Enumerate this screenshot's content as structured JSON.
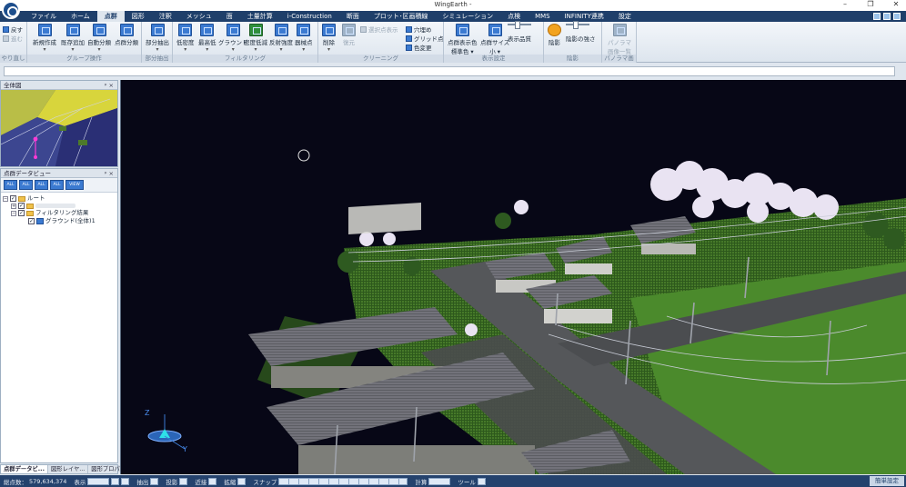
{
  "window": {
    "title": "WingEarth -",
    "controls": [
      "–",
      "❐",
      "✕"
    ]
  },
  "menu": {
    "items": [
      "ファイル",
      "ホーム",
      "点群",
      "図形",
      "注釈",
      "メッシュ",
      "面",
      "土量計算",
      "i-Construction",
      "断面",
      "プロット･区画積線",
      "シミュレーション",
      "点検",
      "MMS",
      "INFINITY連携",
      "設定"
    ],
    "active": "点群"
  },
  "ribbon": {
    "undo": {
      "undo": "戻す",
      "redo": "進む",
      "group": "やり直し"
    },
    "group_edit": {
      "label": "グループ操作",
      "buttons": [
        "新規作成",
        "既存追加",
        "自動分類",
        "点群分類"
      ]
    },
    "partial": {
      "label": "部分抽出",
      "button": "部分抽出"
    },
    "filter": {
      "label": "フィルタリング",
      "buttons": [
        "低密度",
        "最高低",
        "グラウンド",
        "密度低減",
        "反射強度",
        "器械点"
      ]
    },
    "cleaning": {
      "label": "クリーニング",
      "buttons": [
        "削除",
        "復元"
      ],
      "disabled_option": "選択点表示",
      "options": [
        "穴埋め",
        "グリッド点",
        "色変更"
      ]
    },
    "display": {
      "label": "表示設定",
      "color_button": "点群表示色",
      "color_value": "標準色",
      "size_button": "点群サイズ",
      "size_value": "小",
      "quality_label": "表示品質"
    },
    "shadow": {
      "label": "陰影",
      "button": "陰影",
      "strength_label": "陰影の強さ"
    },
    "panorama": {
      "label": "パノラマ画像",
      "button": "パノラマ画像一覧"
    }
  },
  "left_panels": {
    "overview": {
      "title": "全体図"
    },
    "pointcloud": {
      "title": "点群データビュー",
      "toolbar": [
        "ALL",
        "ALL",
        "ALL",
        "ALL",
        "VIEW"
      ],
      "tree": [
        {
          "label": "ルート",
          "level": 0,
          "checked": true
        },
        {
          "label": "",
          "level": 1,
          "checked": true
        },
        {
          "label": "フィルタリング結果",
          "level": 1,
          "checked": true
        },
        {
          "label": "グラウンド(全体)1",
          "level": 2,
          "checked": true
        }
      ]
    },
    "bottom_tabs": [
      "点群データビュー",
      "図形レイヤー",
      "図形プロパティ"
    ],
    "bottom_tabs_display": [
      "点群データビ...",
      "図形レイヤ...",
      "図形プロパテ..."
    ]
  },
  "viewport": {
    "axis": {
      "z": "Z",
      "y": "Y"
    }
  },
  "statusbar": {
    "point_count_label": "総点数：",
    "point_count": "579,634,374",
    "items": [
      "表示",
      "抽出",
      "投影",
      "近接",
      "拡縮",
      "スナップ",
      "計算",
      "ツール"
    ],
    "simple_settings": "簡単設定"
  },
  "colors": {
    "menu_bg": "#1f3f6a",
    "status_bg": "#24426d",
    "viewport_bg": "#070716",
    "accent": "#3b7ad1"
  }
}
